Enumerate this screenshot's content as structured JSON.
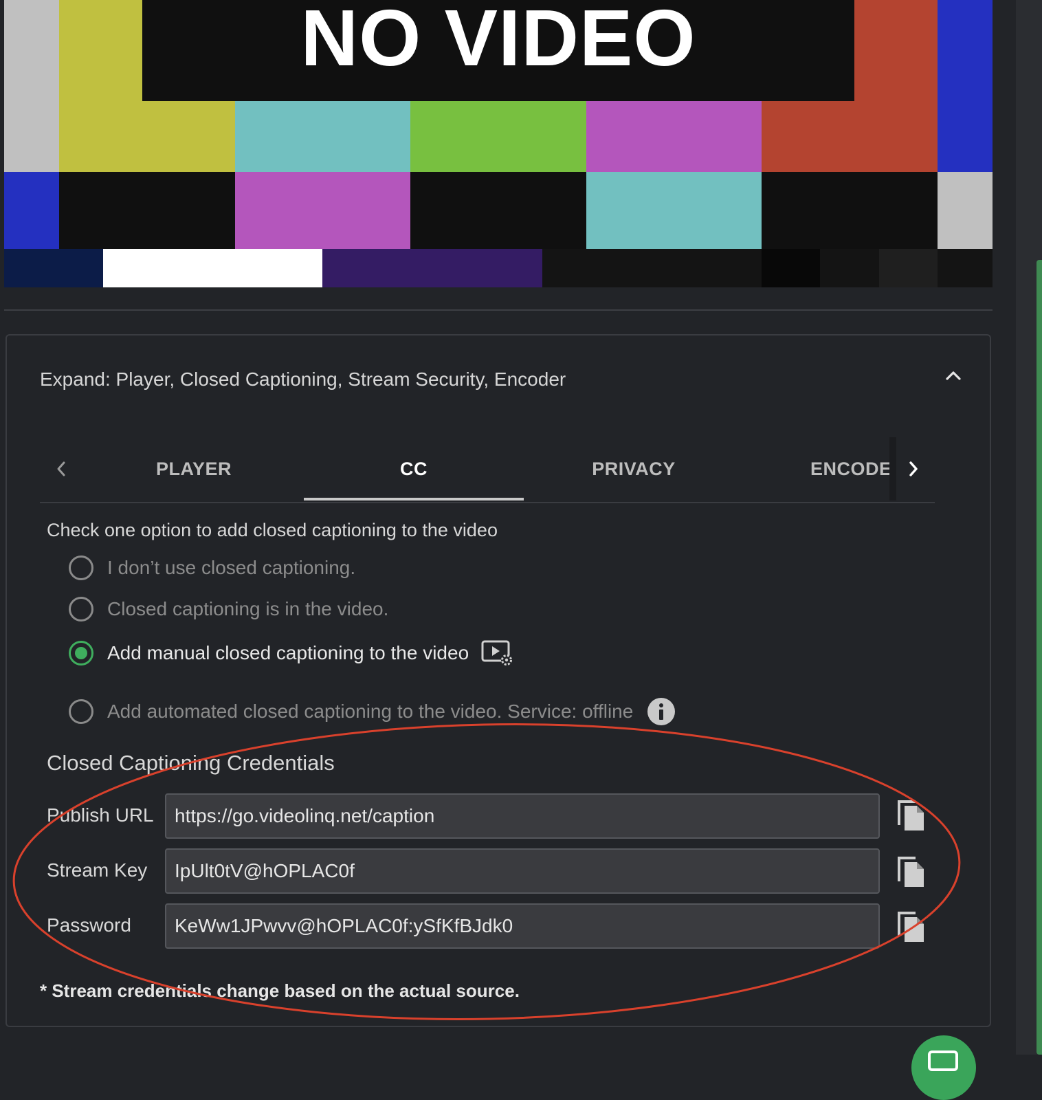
{
  "video": {
    "placeholder_text": "NO VIDEO",
    "colors": {
      "gray": "#c0c0c0",
      "yellow": "#c0c040",
      "cyan": "#72c0c0",
      "green": "#78c040",
      "magenta": "#b456bc",
      "red": "#b44430",
      "blue": "#2430c0",
      "black": "#101010",
      "navy": "#0c1c48",
      "white": "#ffffff",
      "purple": "#341c64"
    }
  },
  "panel": {
    "expand_title": "Expand: Player, Closed Captioning, Stream Security, Encoder",
    "collapse_icon": "chevron-up-icon",
    "tabs": [
      {
        "label": "PLAYER",
        "active": false
      },
      {
        "label": "CC",
        "active": true
      },
      {
        "label": "PRIVACY",
        "active": false
      },
      {
        "label": "ENCODER",
        "active": false
      }
    ],
    "cc": {
      "instruction": "Check one option to add closed captioning to the video",
      "options": [
        {
          "label": "I don’t use closed captioning.",
          "selected": false
        },
        {
          "label": "Closed captioning is in the video.",
          "selected": false
        },
        {
          "label": "Add manual closed captioning to the video",
          "selected": true,
          "icon": "video-settings-icon"
        },
        {
          "label": "Add automated closed captioning to the video. Service: offline",
          "selected": false,
          "icon": "info-icon"
        }
      ],
      "credentials": {
        "title": "Closed Captioning Credentials",
        "publish_url_label": "Publish URL",
        "publish_url": "https://go.videolinq.net/caption",
        "stream_key_label": "Stream Key",
        "stream_key": "IpUlt0tV@hOPLAC0f",
        "password_label": "Password",
        "password": "KeWw1JPwvv@hOPLAC0f:ySfKfBJdk0",
        "copy_icon": "copy-icon"
      },
      "note": "* Stream credentials change based on the actual source."
    }
  },
  "accent_color": "#3fae5e",
  "annotation_color": "#d9412c"
}
